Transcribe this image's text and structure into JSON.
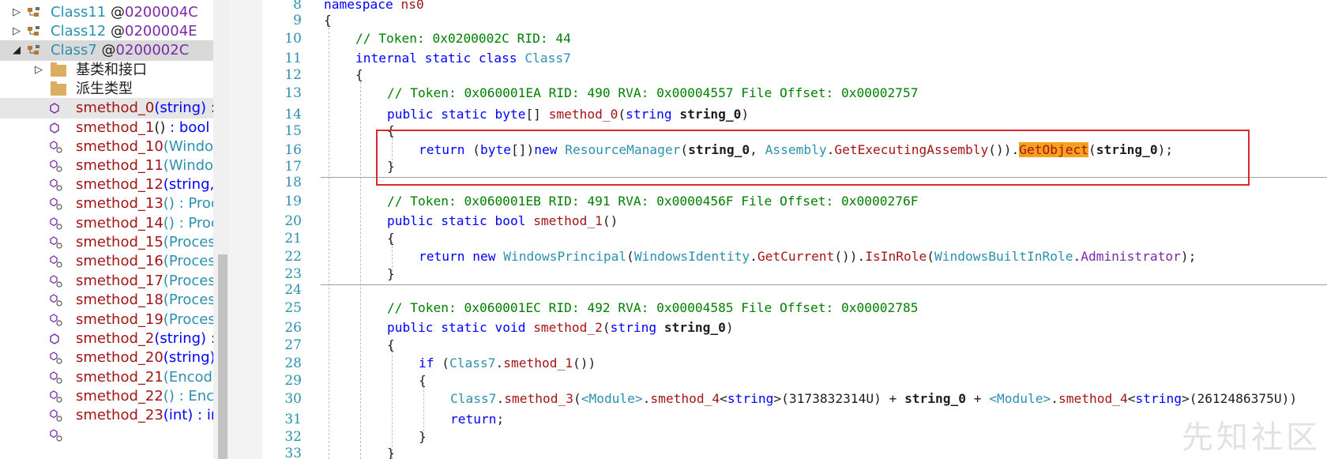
{
  "tree": {
    "rows": [
      {
        "name": "Class11",
        "token": "@0200004C",
        "expander": "▷"
      },
      {
        "name": "Class12",
        "token": "@0200004E",
        "expander": "▷"
      },
      {
        "name": "Class7",
        "token": "@0200002C",
        "expander": "◢"
      },
      {
        "label": "基类和接口",
        "expander": "▷"
      },
      {
        "label": "派生类型"
      },
      {
        "method": "smethod_0",
        "params": "(string)",
        "ret": " : "
      },
      {
        "method": "smethod_1",
        "params": "()",
        "ret": " : bool @"
      },
      {
        "method": "smethod_10",
        "params": "(Windov"
      },
      {
        "method": "smethod_11",
        "params": "(Windov"
      },
      {
        "method": "smethod_12",
        "params": "(string, s"
      },
      {
        "method": "smethod_13",
        "params": "() : Proc"
      },
      {
        "method": "smethod_14",
        "params": "() : Proc"
      },
      {
        "method": "smethod_15",
        "params": "(Process"
      },
      {
        "method": "smethod_16",
        "params": "(Process"
      },
      {
        "method": "smethod_17",
        "params": "(Process"
      },
      {
        "method": "smethod_18",
        "params": "(Process"
      },
      {
        "method": "smethod_19",
        "params": "(Process"
      },
      {
        "method": "smethod_2",
        "params": "(string)",
        "ret": " : v"
      },
      {
        "method": "smethod_20",
        "params": "(string)"
      },
      {
        "method": "smethod_21",
        "params": "(Encodi"
      },
      {
        "method": "smethod_22",
        "params": "() : Enco"
      },
      {
        "method": "smethod_23",
        "params": "(int) : in"
      }
    ]
  },
  "editor": {
    "line_numbers": [
      "8",
      "9",
      "10",
      "11",
      "12",
      "13",
      "14",
      "15",
      "16",
      "17",
      "18",
      "19",
      "20",
      "21",
      "22",
      "23",
      "24",
      "25",
      "26",
      "27",
      "28",
      "29",
      "30",
      "31",
      "32",
      "33"
    ],
    "l8": {
      "kw": "namespace",
      "name": " ns0"
    },
    "l9": "{",
    "l10": "// Token: 0x0200002C RID: 44",
    "l11": {
      "kw": "internal static class ",
      "name": "Class7"
    },
    "l12": "{",
    "l13": "// Token: 0x060001EA RID: 490 RVA: 0x00004557 File Offset: 0x00002757",
    "l14": {
      "kw1": "public static ",
      "kw2": "byte",
      "p1": "[] ",
      "me": "smethod_0",
      "p2": "(",
      "kw3": "string ",
      "b": "string_0",
      "p3": ")"
    },
    "l15": "{",
    "l16": {
      "kw1": "return ",
      "p1": "(",
      "kw2": "byte",
      "p2": "[])",
      "kw3": "new ",
      "ty1": "ResourceManager",
      "p3": "(",
      "b1": "string_0",
      "p4": ", ",
      "ty2": "Assembly",
      "p5": ".",
      "me1": "GetExecutingAssembly",
      "p6": "()).",
      "hl": "GetObject",
      "p7": "(",
      "b2": "string_0",
      "p8": ");"
    },
    "l17": "}",
    "l19": "// Token: 0x060001EB RID: 491 RVA: 0x0000456F File Offset: 0x0000276F",
    "l20": {
      "kw1": "public static ",
      "kw2": "bool ",
      "me": "smethod_1",
      "p1": "()"
    },
    "l21": "{",
    "l22": {
      "kw1": "return ",
      "kw2": "new ",
      "ty1": "WindowsPrincipal",
      "p1": "(",
      "ty2": "WindowsIdentity",
      "p2": ".",
      "me1": "GetCurrent",
      "p3": "()).",
      "me2": "IsInRole",
      "p4": "(",
      "ty3": "WindowsBuiltInRole",
      "p5": ".",
      "me3": "Administrator",
      "p6": ");"
    },
    "l23": "}",
    "l25": "// Token: 0x060001EC RID: 492 RVA: 0x00004585 File Offset: 0x00002785",
    "l26": {
      "kw1": "public static ",
      "kw2": "void ",
      "me": "smethod_2",
      "p1": "(",
      "kw3": "string ",
      "b": "string_0",
      "p2": ")"
    },
    "l27": "{",
    "l28": {
      "kw1": "if ",
      "p1": "(",
      "ty1": "Class7",
      "p2": ".",
      "me1": "smethod_1",
      "p3": "())"
    },
    "l29": "{",
    "l30": {
      "ty1": "Class7",
      "p1": ".",
      "me1": "smethod_3",
      "p2": "(",
      "ty2": "<Module>",
      "p3": ".",
      "me2": "smethod_4",
      "p4": "<",
      "kw1": "string",
      "p5": ">(3173832314U) + ",
      "b": "string_0",
      "p6": " + ",
      "ty3": "<Module>",
      "p7": ".",
      "me3": "smethod_4",
      "p8": "<",
      "kw2": "string",
      "p9": ">(2612486375U))"
    },
    "l31": {
      "kw1": "return",
      "p1": ";"
    },
    "l32": "}",
    "l33": "}"
  },
  "watermark": "先知社区",
  "colors": {
    "comment": "#008000",
    "keyword": "#0000ff",
    "type": "#2b91af",
    "method": "#a31515",
    "highlight": "#f5a11e",
    "redbox": "#e0262c"
  }
}
